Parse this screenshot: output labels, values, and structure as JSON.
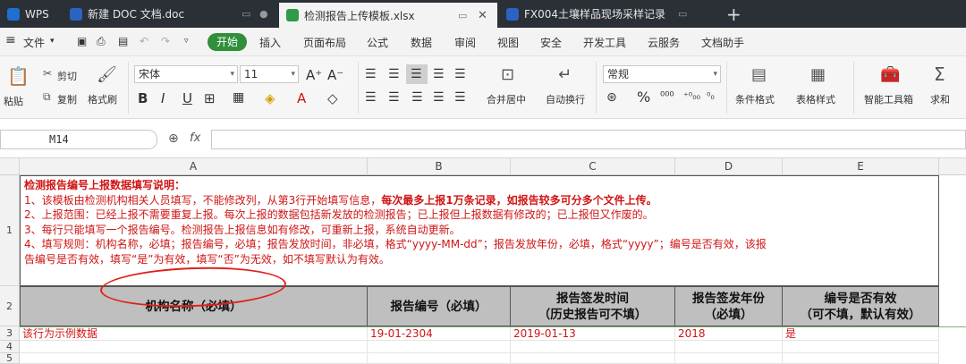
{
  "tabs": [
    {
      "label": "WPS",
      "color": "#1f6fd0"
    },
    {
      "label": "新建 DOC 文档.doc",
      "color": "#2b63c4"
    },
    {
      "label": "检测报告上传模板.xlsx",
      "color": "#2f9a48"
    },
    {
      "label": "FX004土壤样品现场采样记录",
      "color": "#2b63c4"
    }
  ],
  "menu": {
    "file": "文件",
    "start": "开始",
    "items": [
      "插入",
      "页面布局",
      "公式",
      "数据",
      "审阅",
      "视图",
      "安全",
      "开发工具",
      "云服务",
      "文档助手"
    ]
  },
  "ribbon": {
    "paste": "粘贴",
    "cut": "剪切",
    "copy": "复制",
    "format_painter": "格式刷",
    "font_name": "宋体",
    "font_size": "11",
    "merge_center": "合并居中",
    "auto_wrap": "自动换行",
    "number_format": "常规",
    "cond_format": "条件格式",
    "table_style": "表格样式",
    "smart_toolbox": "智能工具箱",
    "sum": "求和"
  },
  "formula_bar": {
    "cell_ref": "M14",
    "fx": "fx",
    "value": ""
  },
  "columns": [
    "A",
    "B",
    "C",
    "D",
    "E"
  ],
  "rows": [
    "1",
    "2",
    "3",
    "4",
    "5"
  ],
  "instructions": {
    "title": "检测报告编号上报数据填写说明：",
    "line1a": "1、该模板由检测机构相关人员填写，不能修改列，从第3行开始填写信息，",
    "line1b": "每次最多上报1万条记录，如报告较多可分多个文件上传。",
    "line2": "2、上报范围：已经上报不需要重复上报。每次上报的数据包括新发放的检测报告；已上报但上报数据有修改的；已上报但又作废的。",
    "line3": "3、每行只能填写一个报告编号。检测报告上报信息如有修改，可重新上报，系统自动更新。",
    "line4": "4、填写规则：机构名称，必填；报告编号，必填；报告发放时间，非必填，格式“yyyy-MM-dd”；报告发放年份，必填，格式“yyyy”；编号是否有效，该报",
    "line5": "告编号是否有效，填写“是”为有效，填写“否”为无效，如不填写默认为有效。"
  },
  "headers": [
    {
      "line1": "机构名称（必填）",
      "line2": ""
    },
    {
      "line1": "报告编号（必填）",
      "line2": ""
    },
    {
      "line1": "报告签发时间",
      "line2": "（历史报告可不填）"
    },
    {
      "line1": "报告签发年份",
      "line2": "（必填）"
    },
    {
      "line1": "编号是否有效",
      "line2": "（可不填，默认有效）"
    }
  ],
  "example_row": [
    "该行为示例数据",
    "19-01-2304",
    "2019-01-13",
    "2018",
    "是"
  ],
  "colors": {
    "accent_green": "#2f8f3a",
    "instruction_red": "#d01515",
    "header_gray": "#bfbfbf",
    "annotation_red": "#e0201a"
  }
}
